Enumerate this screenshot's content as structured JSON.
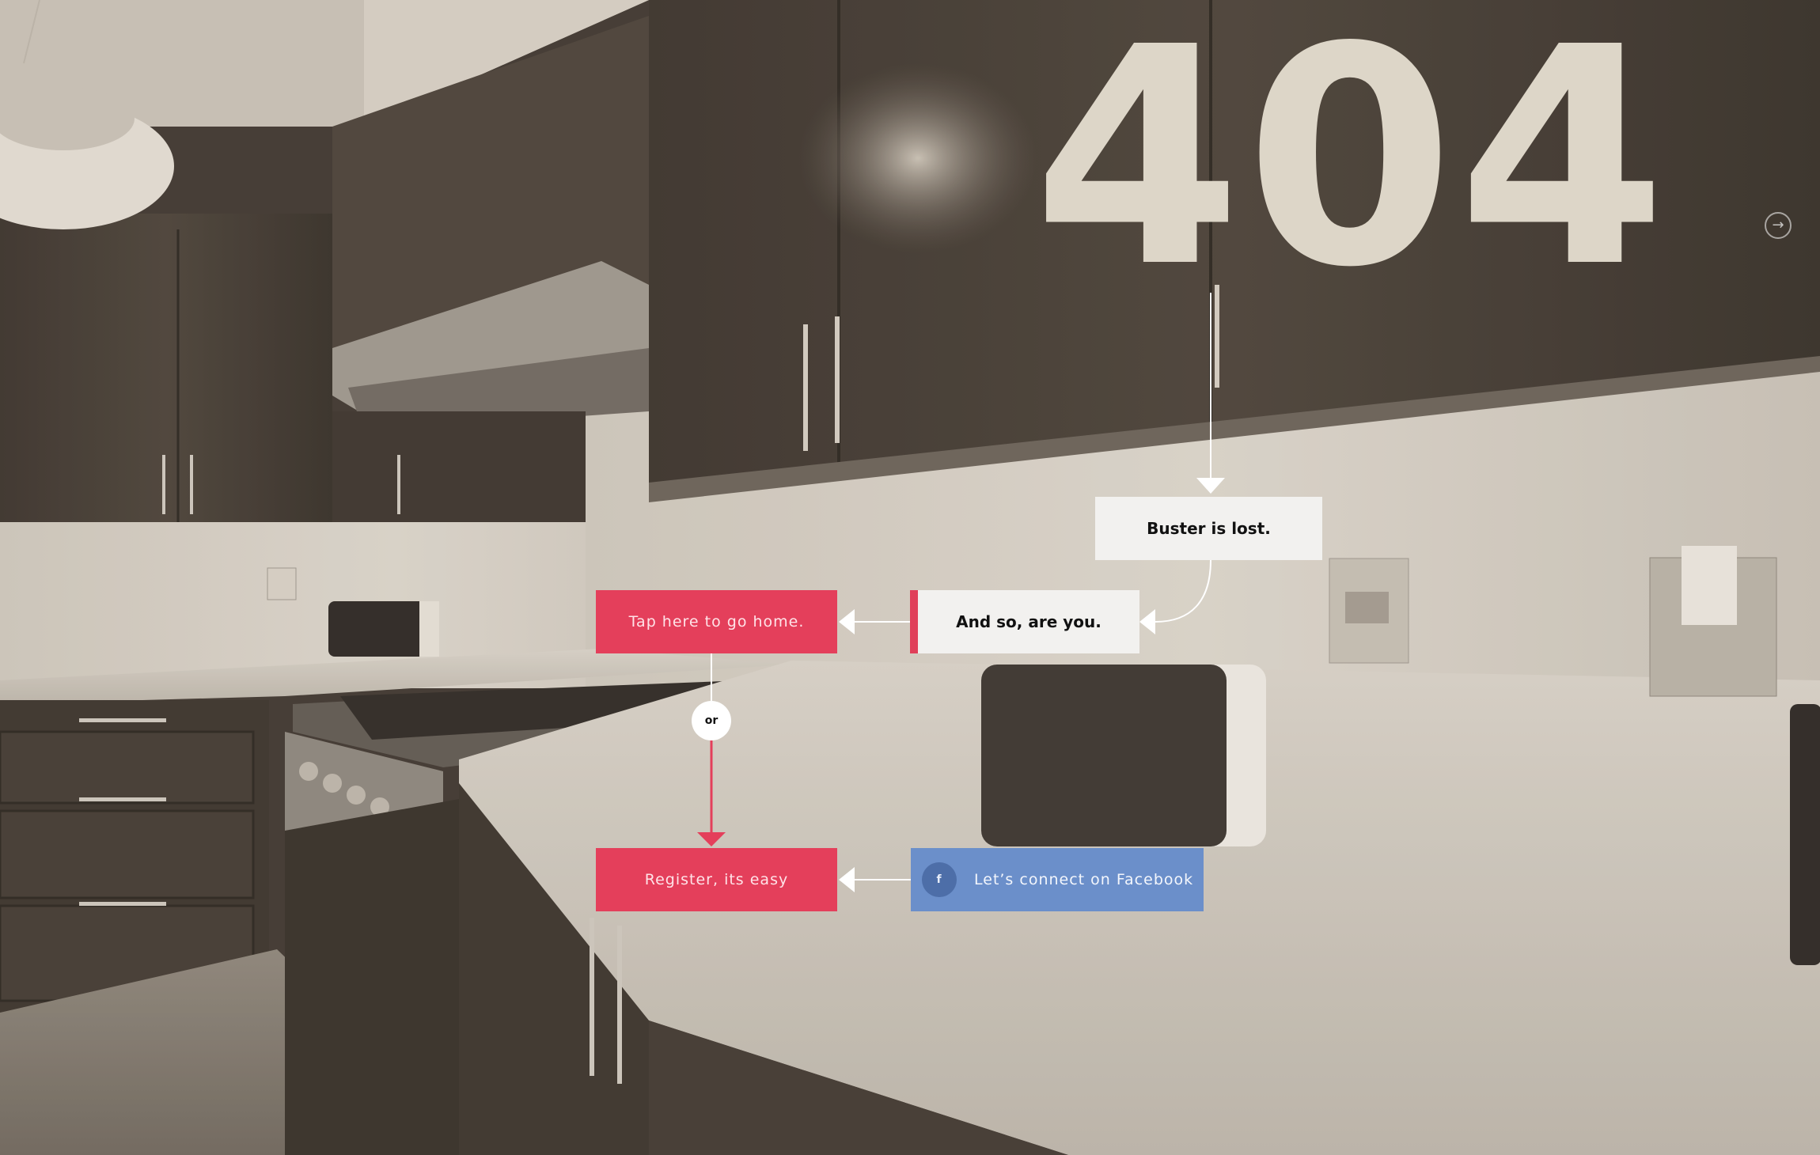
{
  "hero": {
    "code": "404",
    "next_icon": "arrow-right-circle-icon"
  },
  "flow": {
    "lost": "Buster is lost.",
    "you": "And so, are you.",
    "home": "Tap here to go home.",
    "or": "or",
    "register": "Register, its easy",
    "facebook": "Let’s connect on Facebook",
    "facebook_icon": "f"
  },
  "colors": {
    "accent_red": "#e43f5b",
    "facebook_blue": "#6b8fca",
    "panel_light": "#f2f1ef",
    "big_text": "#ddd6c8"
  }
}
